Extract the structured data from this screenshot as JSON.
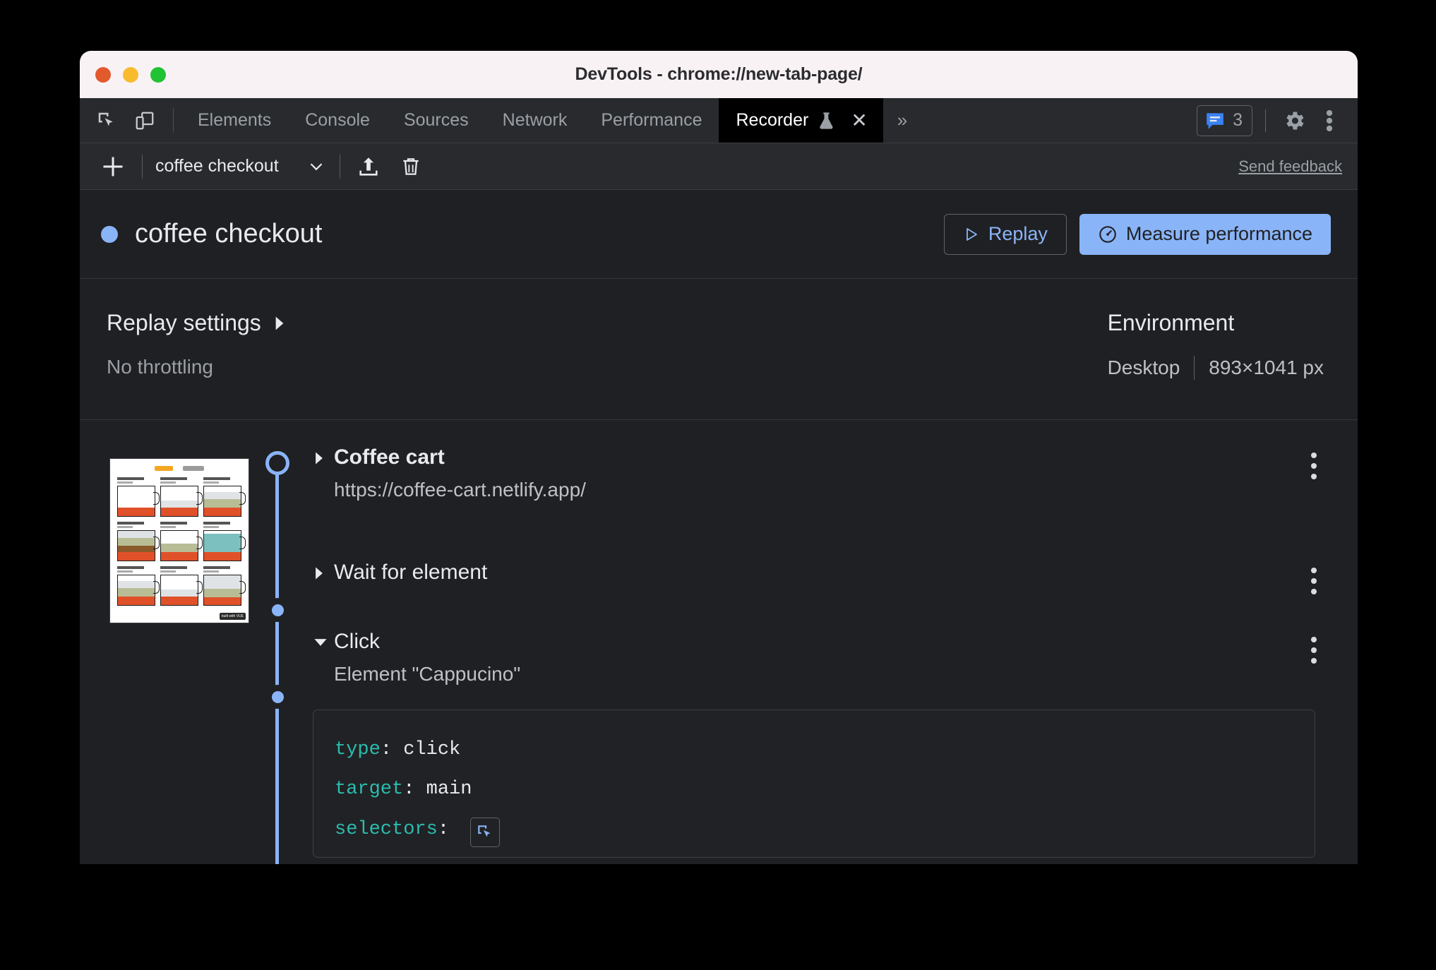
{
  "window": {
    "title": "DevTools - chrome://new-tab-page/",
    "traffic_lights": [
      "close",
      "minimize",
      "zoom"
    ]
  },
  "devtools_tabs": {
    "inspect_icon": "inspect-element-icon",
    "device_icon": "device-toolbar-icon",
    "items": [
      {
        "label": "Elements",
        "active": false
      },
      {
        "label": "Console",
        "active": false
      },
      {
        "label": "Sources",
        "active": false
      },
      {
        "label": "Network",
        "active": false
      },
      {
        "label": "Performance",
        "active": false
      },
      {
        "label": "Recorder",
        "active": true,
        "experimental_icon": "flask-icon",
        "closable": true
      }
    ],
    "overflow_label": "»",
    "issues_count": "3",
    "issues_icon": "issues-message-icon",
    "settings_icon": "gear-icon",
    "menu_icon": "three-dot-vertical-icon"
  },
  "recorder_toolbar": {
    "add_icon": "plus-icon",
    "recording_name": "coffee checkout",
    "dropdown_icon": "chevron-down-icon",
    "export_icon": "export-upload-icon",
    "delete_icon": "trash-icon",
    "feedback_label": "Send feedback"
  },
  "recording_header": {
    "status_dot_color": "#8ab4f8",
    "title": "coffee checkout",
    "replay_label": "Replay",
    "replay_icon": "play-triangle-icon",
    "measure_label": "Measure performance",
    "measure_icon": "performance-gauge-icon"
  },
  "settings": {
    "replay_settings_label": "Replay settings",
    "expand_icon": "chevron-right-icon",
    "throttling_value": "No throttling",
    "environment_label": "Environment",
    "environment_device": "Desktop",
    "environment_viewport": "893×1041 px"
  },
  "thumbnail": {
    "name": "coffee-cart-page-screenshot",
    "badge": "built with VUE"
  },
  "steps": [
    {
      "title": "Coffee cart",
      "subtitle": "https://coffee-cart.netlify.app/",
      "expanded": false,
      "bold": true,
      "node": "start",
      "menu_icon": "three-dot-vertical-icon",
      "caret_icon": "chevron-right-icon"
    },
    {
      "title": "Wait for element",
      "subtitle": "",
      "expanded": false,
      "bold": false,
      "node": "step",
      "menu_icon": "three-dot-vertical-icon",
      "caret_icon": "chevron-right-icon"
    },
    {
      "title": "Click",
      "subtitle": "Element \"Cappucino\"",
      "expanded": true,
      "bold": false,
      "node": "step",
      "menu_icon": "three-dot-vertical-icon",
      "caret_icon": "chevron-down-icon",
      "details": [
        {
          "key": "type",
          "value": "click"
        },
        {
          "key": "target",
          "value": "main"
        },
        {
          "key": "selectors",
          "value": "",
          "icon": "select-element-icon"
        }
      ]
    }
  ]
}
